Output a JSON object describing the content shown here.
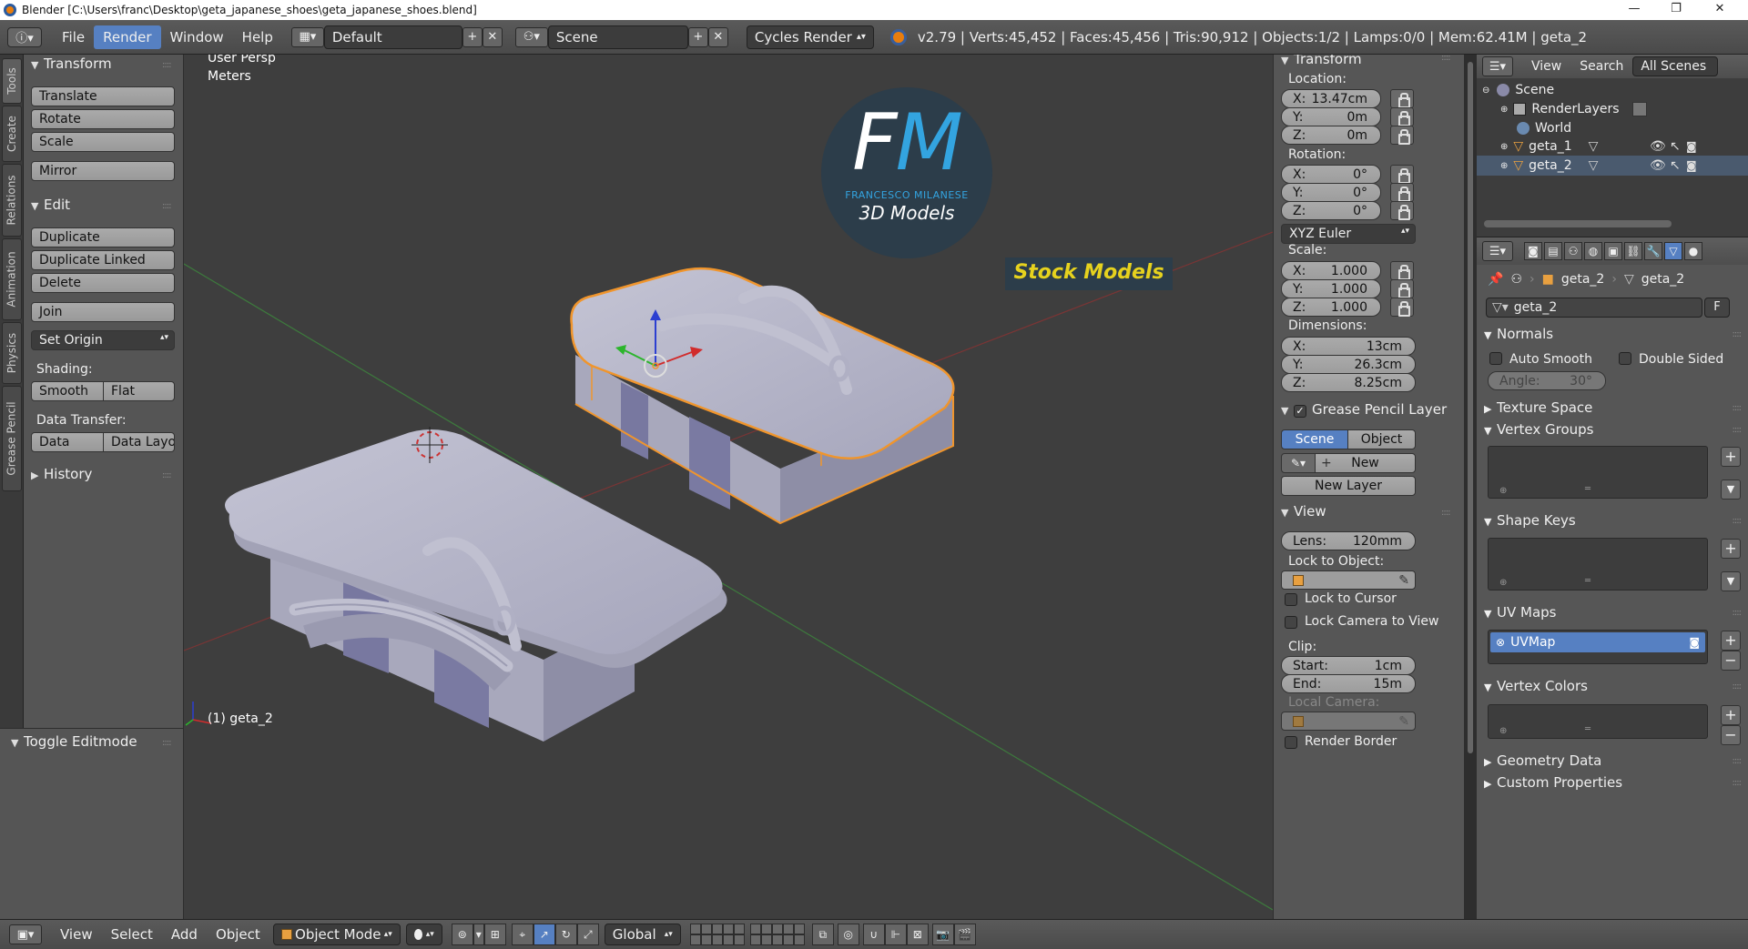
{
  "window": {
    "title": "Blender [C:\\Users\\franc\\Desktop\\geta_japanese_shoes\\geta_japanese_shoes.blend]",
    "controls": {
      "minimize": "—",
      "maximize": "❐",
      "close": "✕"
    }
  },
  "info_header": {
    "menus": [
      "File",
      "Render",
      "Window",
      "Help"
    ],
    "active_menu": "Render",
    "screen_layout": "Default",
    "scene": "Scene",
    "render_engine": "Cycles Render",
    "stats": "v2.79 | Verts:45,452 | Faces:45,456 | Tris:90,912 | Objects:1/2 | Lamps:0/0 | Mem:62.41M | geta_2"
  },
  "left_tabs": [
    "Tools",
    "Create",
    "Relations",
    "Animation",
    "Physics",
    "Grease Pencil"
  ],
  "tool_shelf": {
    "transform_header": "Transform",
    "transform_buttons": [
      "Translate",
      "Rotate",
      "Scale"
    ],
    "mirror": "Mirror",
    "edit_header": "Edit",
    "edit_buttons": [
      "Duplicate",
      "Duplicate Linked",
      "Delete"
    ],
    "join": "Join",
    "set_origin": "Set Origin",
    "shading_label": "Shading:",
    "shading_buttons": [
      "Smooth",
      "Flat"
    ],
    "data_transfer_label": "Data Transfer:",
    "data_transfer_buttons": [
      "Data",
      "Data Layo"
    ],
    "history_header": "History"
  },
  "operator_panel": {
    "header": "Toggle Editmode"
  },
  "viewport": {
    "view_name": "User Persp",
    "units": "Meters",
    "object_label": "(1) geta_2",
    "watermark": {
      "monogram": "FM",
      "author": "FRANCESCO MILANESE",
      "subtitle": "3D Models",
      "banner": "Stock Models"
    }
  },
  "properties_panel": {
    "transform_header": "Transform",
    "location_label": "Location:",
    "location": [
      {
        "axis": "X:",
        "value": "13.47cm"
      },
      {
        "axis": "Y:",
        "value": "0m"
      },
      {
        "axis": "Z:",
        "value": "0m"
      }
    ],
    "rotation_label": "Rotation:",
    "rotation": [
      {
        "axis": "X:",
        "value": "0°"
      },
      {
        "axis": "Y:",
        "value": "0°"
      },
      {
        "axis": "Z:",
        "value": "0°"
      }
    ],
    "rotation_mode": "XYZ Euler",
    "scale_label": "Scale:",
    "scale": [
      {
        "axis": "X:",
        "value": "1.000"
      },
      {
        "axis": "Y:",
        "value": "1.000"
      },
      {
        "axis": "Z:",
        "value": "1.000"
      }
    ],
    "dimensions_label": "Dimensions:",
    "dimensions": [
      {
        "axis": "X:",
        "value": "13cm"
      },
      {
        "axis": "Y:",
        "value": "26.3cm"
      },
      {
        "axis": "Z:",
        "value": "8.25cm"
      }
    ],
    "grease_pencil_header": "Grease Pencil Layer",
    "grease_pencil_tabs": [
      "Scene",
      "Object"
    ],
    "new_label": "New",
    "new_layer_label": "New Layer",
    "view_header": "View",
    "lens_label": "Lens:",
    "lens_value": "120mm",
    "lock_to_object_label": "Lock to Object:",
    "lock_to_cursor": "Lock to Cursor",
    "lock_camera": "Lock Camera to View",
    "clip_label": "Clip:",
    "clip_start_label": "Start:",
    "clip_start": "1cm",
    "clip_end_label": "End:",
    "clip_end": "15m",
    "local_camera_label": "Local Camera:",
    "render_border": "Render Border"
  },
  "outliner": {
    "menus": [
      "View",
      "Search"
    ],
    "display_mode": "All Scenes",
    "items": [
      {
        "name": "Scene",
        "icon": "scene-icon"
      },
      {
        "name": "RenderLayers",
        "icon": "render-layers-icon"
      },
      {
        "name": "World",
        "icon": "world-icon"
      },
      {
        "name": "geta_1",
        "icon": "mesh-object-icon"
      },
      {
        "name": "geta_2",
        "icon": "mesh-object-icon"
      }
    ]
  },
  "properties_editor": {
    "breadcrumb": [
      "geta_2",
      "geta_2"
    ],
    "mesh_name": "geta_2",
    "fake_user": "F",
    "normals_header": "Normals",
    "auto_smooth": "Auto Smooth",
    "double_sided": "Double Sided",
    "angle_label": "Angle:",
    "angle_value": "30°",
    "texture_space": "Texture Space",
    "vertex_groups": "Vertex Groups",
    "shape_keys": "Shape Keys",
    "uv_maps": "UV Maps",
    "uv_map_item": "UVMap",
    "vertex_colors": "Vertex Colors",
    "geometry_data": "Geometry Data",
    "custom_properties": "Custom Properties"
  },
  "view_header": {
    "menus": [
      "View",
      "Select",
      "Add",
      "Object"
    ],
    "mode": "Object Mode",
    "orientation": "Global"
  },
  "colors": {
    "accent": "#5680c2",
    "selection_outline": "#f0952c",
    "watermark_blue": "#33a4e0",
    "banner_yellow": "#e6d21e"
  }
}
